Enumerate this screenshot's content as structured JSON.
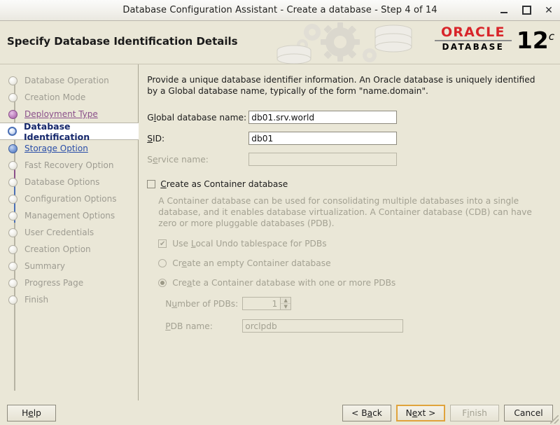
{
  "window": {
    "title": "Database Configuration Assistant - Create a database - Step 4 of 14",
    "minimize_label": "–",
    "maximize_label": "□",
    "close_label": "✕"
  },
  "header": {
    "title": "Specify Database Identification Details",
    "brand": "ORACLE",
    "brand_sub": "DATABASE",
    "version": "12",
    "version_sup": "c",
    "brand_color": "#d8252a"
  },
  "sidebar": {
    "steps": [
      {
        "label": "Database Operation",
        "state": "pending"
      },
      {
        "label": "Creation Mode",
        "state": "pending"
      },
      {
        "label": "Deployment Type",
        "state": "visited"
      },
      {
        "label": "Database Identification",
        "state": "current"
      },
      {
        "label": "Storage Option",
        "state": "available"
      },
      {
        "label": "Fast Recovery Option",
        "state": "pending"
      },
      {
        "label": "Database Options",
        "state": "pending"
      },
      {
        "label": "Configuration Options",
        "state": "pending"
      },
      {
        "label": "Management Options",
        "state": "pending"
      },
      {
        "label": "User Credentials",
        "state": "pending"
      },
      {
        "label": "Creation Option",
        "state": "pending"
      },
      {
        "label": "Summary",
        "state": "pending"
      },
      {
        "label": "Progress Page",
        "state": "pending"
      },
      {
        "label": "Finish",
        "state": "pending"
      }
    ]
  },
  "main": {
    "intro": "Provide a unique database identifier information. An Oracle database is uniquely identified by a Global database name, typically of the form \"name.domain\".",
    "fields": [
      {
        "label_pre": "G",
        "label_mn": "l",
        "label_post": "obal database name:",
        "value": "db01.srv.world",
        "disabled": false
      },
      {
        "label_pre": "",
        "label_mn": "S",
        "label_post": "ID:",
        "value": "db01",
        "disabled": false
      },
      {
        "label_pre": "S",
        "label_mn": "e",
        "label_post": "rvice name:",
        "value": "",
        "disabled": true
      }
    ],
    "container": {
      "checkbox_label_pre": "",
      "checkbox_label_mn": "C",
      "checkbox_label_post": "reate as Container database",
      "checked": false,
      "description": "A Container database can be used for consolidating multiple databases into a single database, and it enables database virtualization. A Container database (CDB) can have zero or more pluggable databases (PDB).",
      "local_undo": {
        "label_pre": "Use ",
        "label_mn": "L",
        "label_post": "ocal Undo tablespace for PDBs",
        "checked": true,
        "check_glyph": "✔"
      },
      "radios": [
        {
          "label_pre": "Cr",
          "label_mn": "e",
          "label_post": "ate an empty Container database",
          "selected": false
        },
        {
          "label_pre": "Cre",
          "label_mn": "a",
          "label_post": "te a Container database with one or more PDBs",
          "selected": true
        }
      ],
      "pdb_count": {
        "label_pre": "N",
        "label_mn": "u",
        "label_post": "mber of PDBs:",
        "value": "1",
        "up_glyph": "▲",
        "down_glyph": "▼"
      },
      "pdb_name": {
        "label_pre": "",
        "label_mn": "P",
        "label_post": "DB name:",
        "value": "orclpdb"
      }
    }
  },
  "footer": {
    "help": {
      "pre": "H",
      "mn": "e",
      "post": "lp"
    },
    "back": {
      "pre": "< B",
      "mn": "a",
      "post": "ck"
    },
    "next": {
      "pre": "N",
      "mn": "e",
      "post": "xt >"
    },
    "finish": {
      "pre": "F",
      "mn": "i",
      "post": "nish"
    },
    "cancel": {
      "pre": "Cancel",
      "mn": "",
      "post": ""
    }
  }
}
